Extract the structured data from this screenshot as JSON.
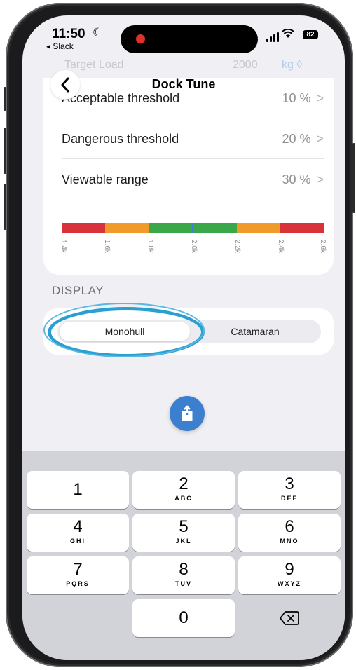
{
  "status_bar": {
    "time": "11:50",
    "back_app": "◂ Slack",
    "battery": "82"
  },
  "background_row": {
    "label": "Target Load",
    "value": "2000",
    "unit": "kg ◊"
  },
  "nav": {
    "title": "Dock Tune"
  },
  "settings": [
    {
      "label": "Acceptable threshold",
      "value": "10 %",
      "chevron": ">"
    },
    {
      "label": "Dangerous threshold",
      "value": "20 %",
      "chevron": ">"
    },
    {
      "label": "Viewable range",
      "value": "30 %",
      "chevron": ">"
    }
  ],
  "range_scale": {
    "ticks": [
      "1.4k",
      "1.6k",
      "1.8k",
      "2.0k",
      "2.2k",
      "2.4k",
      "2.6k"
    ],
    "colors": {
      "danger": "#d8333a",
      "warn": "#f09a2a",
      "ok": "#3aa84a",
      "marker": "#3d7fcf"
    }
  },
  "display": {
    "header": "DISPLAY",
    "options": [
      "Monohull",
      "Catamaran"
    ],
    "selected": "Monohull"
  },
  "keypad": {
    "keys": [
      {
        "digit": "1",
        "letters": ""
      },
      {
        "digit": "2",
        "letters": "ABC"
      },
      {
        "digit": "3",
        "letters": "DEF"
      },
      {
        "digit": "4",
        "letters": "GHI"
      },
      {
        "digit": "5",
        "letters": "JKL"
      },
      {
        "digit": "6",
        "letters": "MNO"
      },
      {
        "digit": "7",
        "letters": "PQRS"
      },
      {
        "digit": "8",
        "letters": "TUV"
      },
      {
        "digit": "9",
        "letters": "WXYZ"
      },
      {
        "digit": "0",
        "letters": ""
      }
    ]
  },
  "colors": {
    "accent": "#3d7fcf",
    "highlight": "#2a9fd2"
  }
}
